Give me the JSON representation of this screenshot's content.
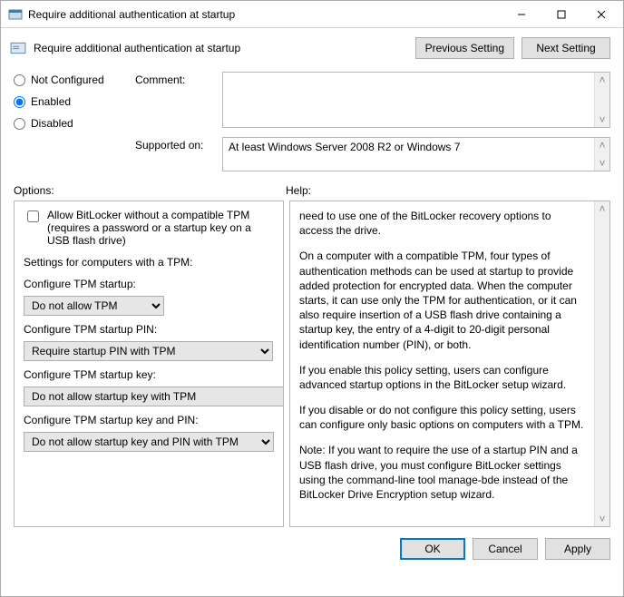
{
  "window": {
    "title": "Require additional authentication at startup"
  },
  "header": {
    "title": "Require additional authentication at startup",
    "prev": "Previous Setting",
    "next": "Next Setting"
  },
  "config": {
    "radios": {
      "not_configured": "Not Configured",
      "enabled": "Enabled",
      "disabled": "Disabled",
      "selected": "enabled"
    },
    "comment_label": "Comment:",
    "comment_value": "",
    "supported_label": "Supported on:",
    "supported_value": "At least Windows Server 2008 R2 or Windows 7"
  },
  "labels": {
    "options": "Options:",
    "help": "Help:"
  },
  "options": {
    "allow_no_tpm_checked": false,
    "allow_no_tpm_label": "Allow BitLocker without a compatible TPM (requires a password or a startup key on a USB flash drive)",
    "tpm_settings_title": "Settings for computers with a TPM:",
    "startup_label": "Configure TPM startup:",
    "startup_value": "Do not allow TPM",
    "pin_label": "Configure TPM startup PIN:",
    "pin_value": "Require startup PIN with TPM",
    "key_label": "Configure TPM startup key:",
    "key_value": "Do not allow startup key with TPM",
    "keypin_label": "Configure TPM startup key and PIN:",
    "keypin_value": "Do not allow startup key and PIN with TPM"
  },
  "help": {
    "p1": "need to use one of the BitLocker recovery options to access the drive.",
    "p2": "On a computer with a compatible TPM, four types of authentication methods can be used at startup to provide added protection for encrypted data. When the computer starts, it can use only the TPM for authentication, or it can also require insertion of a USB flash drive containing a startup key, the entry of a 4-digit to 20-digit personal identification number (PIN), or both.",
    "p3": "If you enable this policy setting, users can configure advanced startup options in the BitLocker setup wizard.",
    "p4": "If you disable or do not configure this policy setting, users can configure only basic options on computers with a TPM.",
    "p5": "Note: If you want to require the use of a startup PIN and a USB flash drive, you must configure BitLocker settings using the command-line tool manage-bde instead of the BitLocker Drive Encryption setup wizard."
  },
  "footer": {
    "ok": "OK",
    "cancel": "Cancel",
    "apply": "Apply"
  }
}
